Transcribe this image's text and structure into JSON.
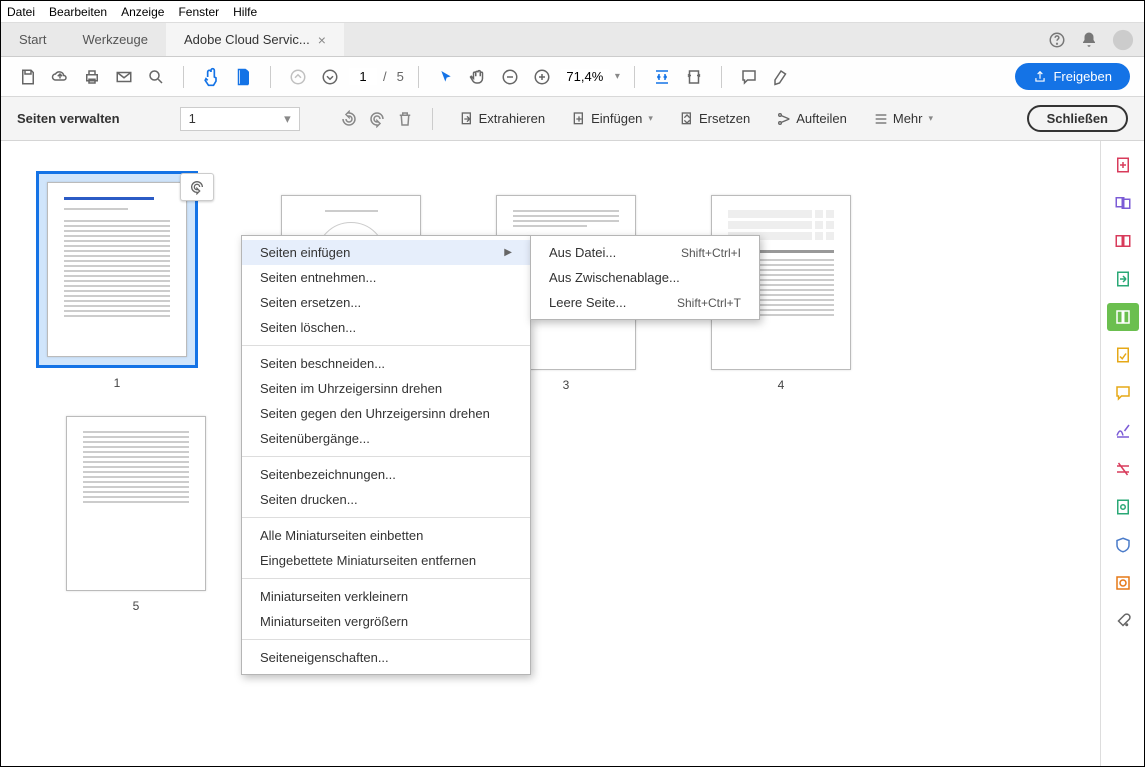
{
  "menubar": [
    "Datei",
    "Bearbeiten",
    "Anzeige",
    "Fenster",
    "Hilfe"
  ],
  "tabs": {
    "start": "Start",
    "tools": "Werkzeuge",
    "doc": "Adobe Cloud Servic..."
  },
  "toolbar": {
    "current_page": "1",
    "page_sep": "/",
    "total_pages": "5",
    "zoom": "71,4%",
    "share": "Freigeben"
  },
  "subtoolbar": {
    "title": "Seiten verwalten",
    "page_selector": "1",
    "extract": "Extrahieren",
    "insert": "Einfügen",
    "replace": "Ersetzen",
    "split": "Aufteilen",
    "more": "Mehr",
    "close": "Schließen"
  },
  "thumbnails": {
    "p1": "1",
    "p3": "3",
    "p4": "4",
    "p5": "5"
  },
  "context_menu": {
    "insert": "Seiten einfügen",
    "extract": "Seiten entnehmen...",
    "replace": "Seiten ersetzen...",
    "delete": "Seiten löschen...",
    "crop": "Seiten beschneiden...",
    "rotate_cw": "Seiten im Uhrzeigersinn drehen",
    "rotate_ccw": "Seiten gegen den Uhrzeigersinn drehen",
    "transitions": "Seitenübergänge...",
    "labels": "Seitenbezeichnungen...",
    "print": "Seiten drucken...",
    "embed_all": "Alle Miniaturseiten einbetten",
    "remove_embedded": "Eingebettete Miniaturseiten entfernen",
    "shrink": "Miniaturseiten verkleinern",
    "enlarge": "Miniaturseiten vergrößern",
    "properties": "Seiteneigenschaften..."
  },
  "submenu": {
    "from_file": "Aus Datei...",
    "from_file_sc": "Shift+Ctrl+I",
    "from_clipboard": "Aus Zwischenablage...",
    "blank": "Leere Seite...",
    "blank_sc": "Shift+Ctrl+T"
  }
}
